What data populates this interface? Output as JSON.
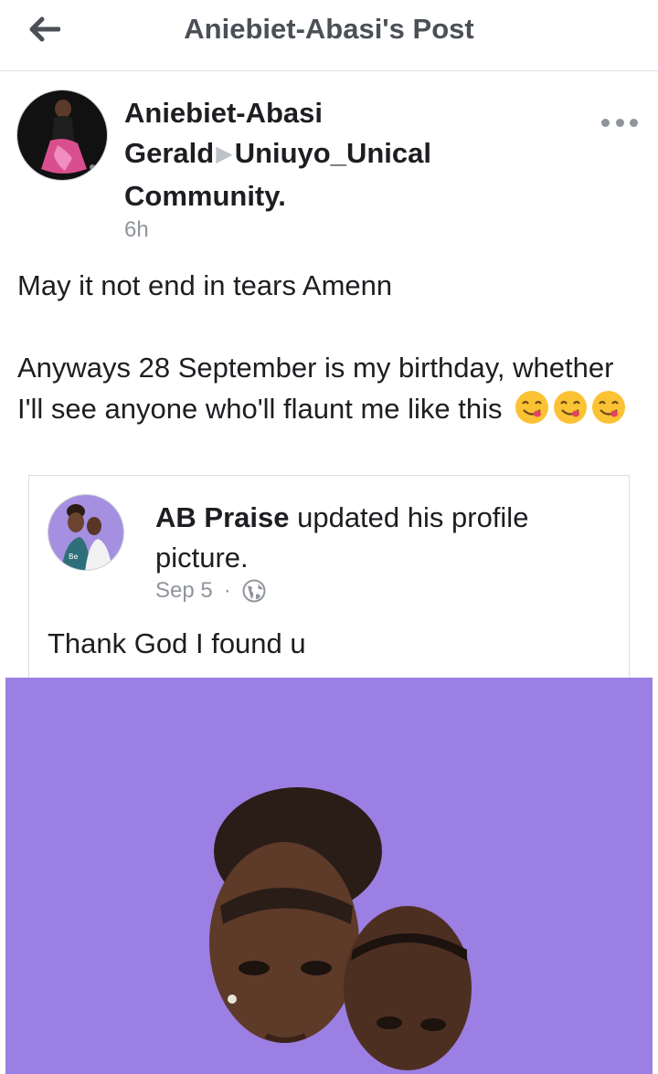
{
  "header": {
    "title": "Aniebiet-Abasi's Post",
    "back_icon": "arrow-left-icon"
  },
  "post": {
    "author": "Aniebiet-Abasi Gerald",
    "arrow": "▶",
    "group": "Uniuyo_Unical Community.",
    "time": "6h",
    "text_line1": "May it not end in tears Amenn",
    "text_line2": "Anyways 28 September is my birthday, whether I'll see anyone who'll flaunt me like this",
    "emojis": [
      "face-savoring-food-emoji",
      "face-savoring-food-emoji",
      "face-savoring-food-emoji"
    ]
  },
  "shared": {
    "author": "AB Praise",
    "action": "updated his profile picture.",
    "date": "Sep 5",
    "separator": "·",
    "privacy_icon": "globe-icon",
    "text": "Thank God I found u"
  },
  "colors": {
    "title_gray": "#4b4f56",
    "meta_gray": "#90949c",
    "photo_bg": "#9a7ce0",
    "emoji_yellow": "#fbc234"
  }
}
